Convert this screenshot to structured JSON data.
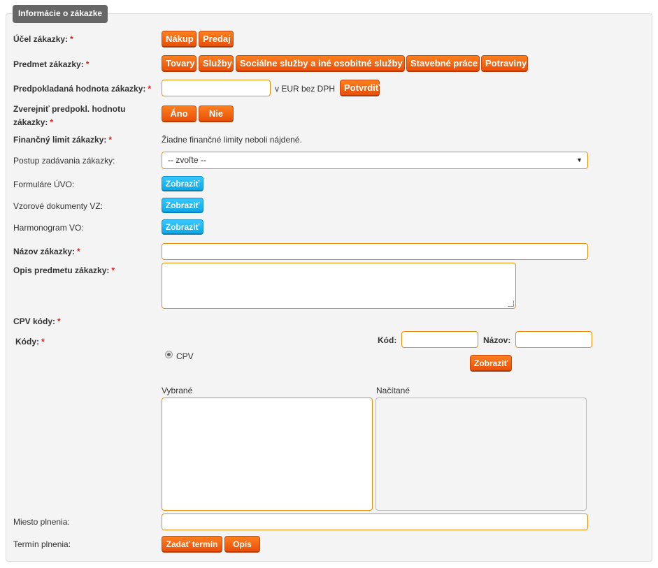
{
  "legend": "Informácie o zákazke",
  "required_mark": "*",
  "rows": {
    "ucel": {
      "label": "Účel zákazky:",
      "buttons": [
        "Nákup",
        "Predaj"
      ]
    },
    "predmet": {
      "label": "Predmet zákazky:",
      "buttons": [
        "Tovary",
        "Služby",
        "Sociálne služby a iné osobitné služby",
        "Stavebné práce",
        "Potraviny"
      ]
    },
    "hodnota": {
      "label": "Predpokladaná hodnota zákazky:",
      "value": "",
      "unit": "v EUR bez DPH",
      "confirm": "Potvrdiť"
    },
    "zverejnit": {
      "label_line1": "Zverejniť predpokl. hodnotu",
      "label_line2": "zákazky:",
      "buttons": [
        "Áno",
        "Nie"
      ]
    },
    "limit": {
      "label": "Finančný limit zákazky:",
      "text": "Žiadne finančné limity neboli nájdené."
    },
    "postup": {
      "label": "Postup zadávania zákazky:",
      "selected": "-- zvoľte --"
    },
    "formulare": {
      "label": "Formuláre ÚVO:",
      "button": "Zobraziť"
    },
    "vzorove": {
      "label": "Vzorové dokumenty VZ:",
      "button": "Zobraziť"
    },
    "harmonogram": {
      "label": "Harmonogram VO:",
      "button": "Zobraziť"
    },
    "nazov": {
      "label": "Názov zákazky:",
      "value": ""
    },
    "opis": {
      "label": "Opis predmetu zákazky:",
      "value": ""
    },
    "cpv": {
      "label": "CPV kódy:",
      "kody_label": "Kódy:",
      "kod_label": "Kód:",
      "nazov_label": "Názov:",
      "kod_value": "",
      "nazov_value": "",
      "show_button": "Zobraziť",
      "radio_label": "CPV",
      "selected_label": "Vybrané",
      "loaded_label": "Načítané"
    },
    "miesto": {
      "label": "Miesto plnenia:",
      "value": ""
    },
    "termin": {
      "label": "Termín plnenia:",
      "buttons": [
        "Zadať termín",
        "Opis"
      ]
    }
  },
  "colors": {
    "accent_orange": "#e8500a",
    "accent_blue": "#0da8e6",
    "required": "#e02020"
  }
}
